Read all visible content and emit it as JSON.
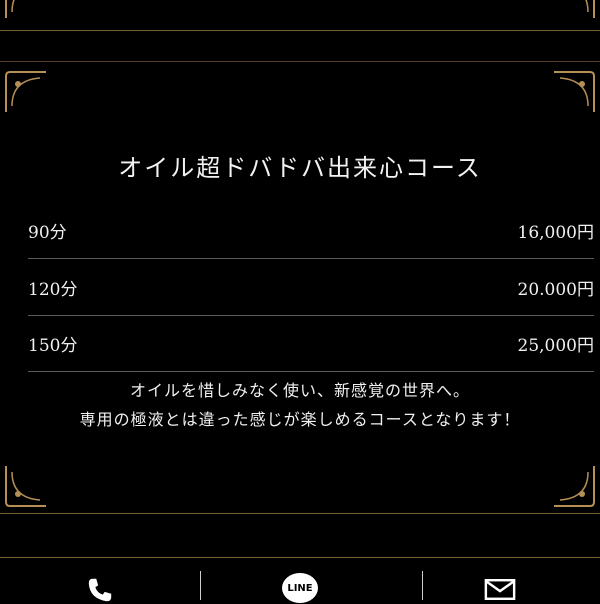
{
  "course": {
    "title": "オイル超ドバドバ出来心コース",
    "rows": [
      {
        "duration": "90分",
        "price": "16,000円"
      },
      {
        "duration": "120分",
        "price": "20.000円"
      },
      {
        "duration": "150分",
        "price": "25,000円"
      }
    ],
    "description": [
      "オイルを惜しみなく使い、新感覚の世界へ。",
      "専用の極液とは違った感じが楽しめるコースとなります！"
    ]
  },
  "footer": {
    "items": [
      {
        "icon": "phone-icon"
      },
      {
        "icon": "line-icon",
        "label": "LINE"
      },
      {
        "icon": "mail-icon"
      }
    ]
  },
  "colors": {
    "background": "#000000",
    "gold": "#8a6a3b",
    "text": "#f0f0f0",
    "divider": "#5a5a5a"
  }
}
